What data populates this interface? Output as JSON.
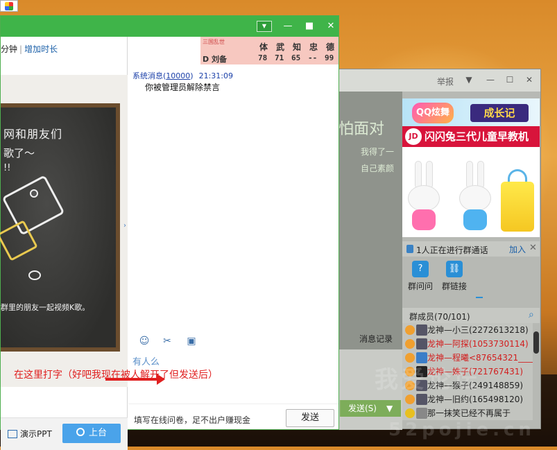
{
  "back_window": {
    "report_label": "举报",
    "chat_handwriting_1": "怕面对",
    "chat_handwriting_2": "我得了一",
    "chat_handwriting_3": "自己素颜",
    "history_label": "消息记录",
    "send_label": "发送(S)",
    "ad": {
      "game_label": "QQ炫舞",
      "growth_label": "成长记",
      "jd_logo": "JD",
      "banner_text": "闪闪兔三代儿童早教机"
    },
    "call_bar": {
      "text": "1人正在进行群通话",
      "join_label": "加入"
    },
    "tools": [
      {
        "icon": "?",
        "label": "群问问"
      },
      {
        "icon": "⛓",
        "label": "群链接"
      }
    ],
    "members_title": "群成员(70/101)",
    "members": [
      "龙神—小三(2272613218)",
      "龙神—阿探(1053730114)",
      "龙神—程曦<87654321_____",
      "龙神—姝子(721767431)",
      "龙神—猴子(249148859)",
      "龙神—旧约(165498120)",
      "那一抹笑已经不再属于"
    ]
  },
  "main_window": {
    "time_left_label": "分钟",
    "add_time_label": "增加时长",
    "board": {
      "line1": "网和朋友们",
      "line2": "歌了～",
      "line3": "!!",
      "caption": "群里的朋友一起视频K歌。"
    },
    "ppt_label": "演示PPT",
    "go_label": "上台",
    "stats": {
      "game": "三国乱世",
      "headers": [
        "体",
        "武",
        "知",
        "忠",
        "德"
      ],
      "name_label": "D 刘备",
      "values": [
        "78",
        "71",
        "65",
        "--",
        "99"
      ]
    },
    "message": {
      "sender": "系统消息",
      "sender_id": "10000",
      "time": "21:31:09",
      "body": "你被管理员解除禁言"
    },
    "input_text": "有人么",
    "annotation": "在这里打字（好吧我现在被人解开了但发送后）",
    "survey_text": "填写在线问卷，足不出户赚现金",
    "send_label": "发送"
  },
  "watermark": "我爱论坛",
  "watermark_url": "52pojie.cn"
}
